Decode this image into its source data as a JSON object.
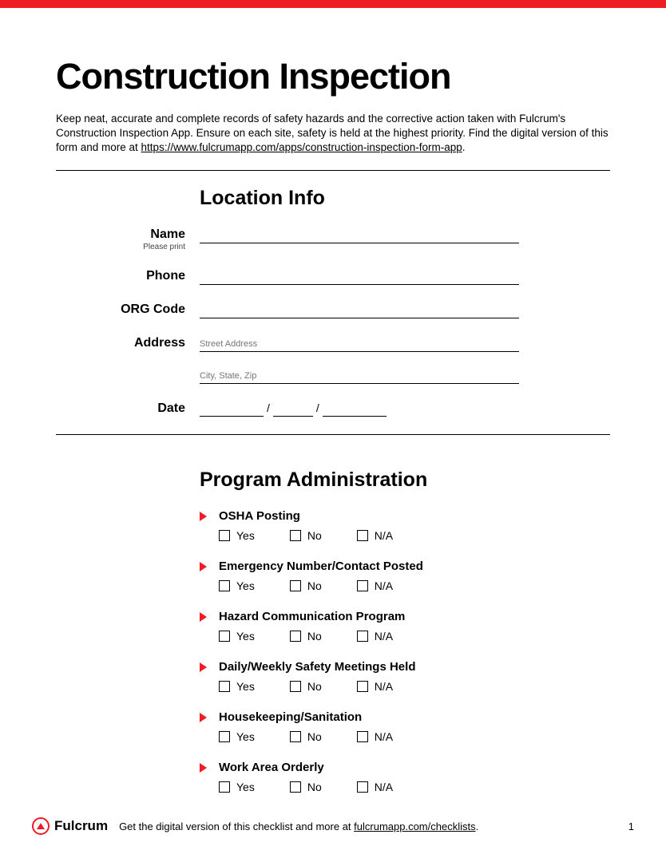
{
  "header": {
    "title": "Construction Inspection",
    "intro_prefix": "Keep neat, accurate and complete records of safety hazards and the corrective action taken with Fulcrum's Construction Inspection App. Ensure on each site, safety is held at the highest priority. Find the digital version of this form and more at ",
    "intro_link": "https://www.fulcrumapp.com/apps/construction-inspection-form-app",
    "intro_suffix": "."
  },
  "location": {
    "heading": "Location Info",
    "name_label": "Name",
    "name_hint": "Please print",
    "phone_label": "Phone",
    "org_label": "ORG Code",
    "address_label": "Address",
    "street_placeholder": "Street Address",
    "city_placeholder": "City, State, Zip",
    "date_label": "Date",
    "date_sep": "/"
  },
  "program": {
    "heading": "Program Administration",
    "options": {
      "yes": "Yes",
      "no": "No",
      "na": "N/A"
    },
    "items": [
      {
        "label": "OSHA Posting"
      },
      {
        "label": "Emergency Number/Contact Posted"
      },
      {
        "label": "Hazard Communication Program"
      },
      {
        "label": "Daily/Weekly Safety Meetings Held"
      },
      {
        "label": "Housekeeping/Sanitation"
      },
      {
        "label": "Work Area Orderly"
      }
    ]
  },
  "footer": {
    "brand": "Fulcrum",
    "text_prefix": "Get the digital version of this checklist and more at ",
    "link": "fulcrumapp.com/checklists",
    "text_suffix": ".",
    "page_number": "1"
  }
}
